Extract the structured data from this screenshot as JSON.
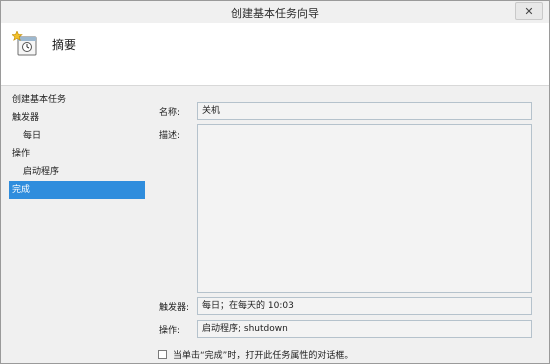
{
  "window": {
    "title": "创建基本任务向导",
    "close_glyph": "✕"
  },
  "header": {
    "title": "摘要",
    "icon": "task-wizard-icon"
  },
  "nav": {
    "items": [
      {
        "label": "创建基本任务"
      },
      {
        "label": "触发器"
      },
      {
        "label": "每日"
      },
      {
        "label": "操作"
      },
      {
        "label": "启动程序"
      },
      {
        "label": "完成"
      }
    ],
    "active_color": "#2f8ddd"
  },
  "form": {
    "name_label": "名称:",
    "name_value": "关机",
    "description_label": "描述:",
    "description_value": "",
    "trigger_label": "触发器:",
    "trigger_value": "每日；在每天的 10:03",
    "action_label": "操作:",
    "action_value": "启动程序; shutdown",
    "open_properties_checkbox": {
      "label": "当单击“完成”时，打开此任务属性的对话框。",
      "checked": false
    }
  }
}
